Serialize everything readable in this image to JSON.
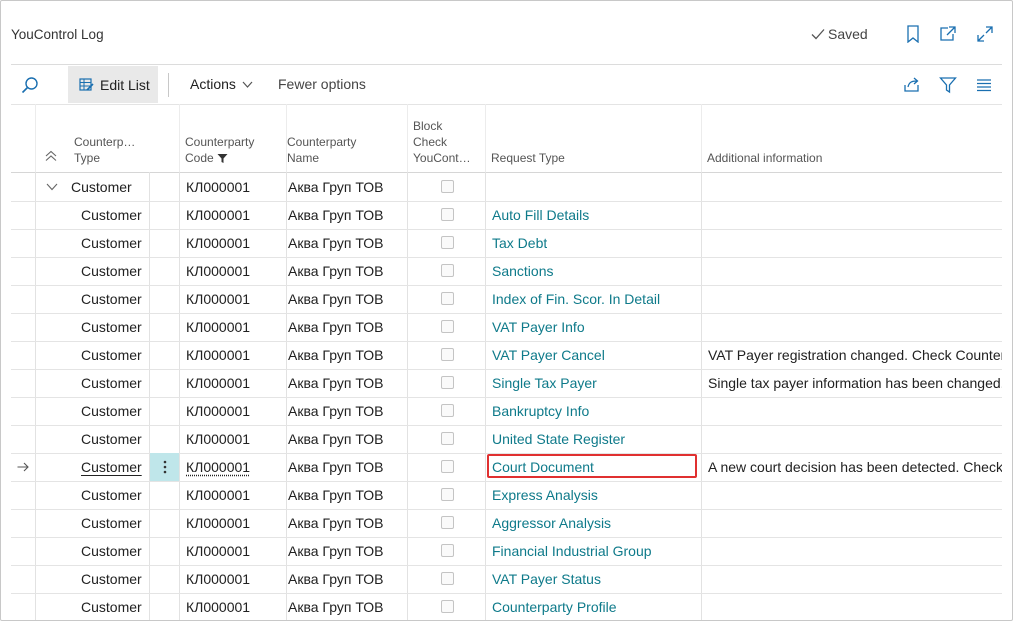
{
  "window": {
    "title": "YouControl Log",
    "saved_label": "Saved"
  },
  "actionbar": {
    "edit_list": "Edit List",
    "actions": "Actions",
    "fewer_options": "Fewer options"
  },
  "columns": {
    "type": [
      "Counterp…",
      "Type"
    ],
    "code": [
      "Counterparty",
      "Code"
    ],
    "name": [
      "Counterparty",
      "Name"
    ],
    "block": [
      "Block",
      "Check",
      "YouCont…"
    ],
    "request": "Request Type",
    "info": "Additional information"
  },
  "group_row": {
    "type": "Customer",
    "code": "КЛ000001",
    "name": "Аква Груп ТОВ"
  },
  "rows": [
    {
      "type": "Customer",
      "code": "КЛ000001",
      "name": "Аква Груп ТОВ",
      "request": "Auto Fill Details",
      "info": ""
    },
    {
      "type": "Customer",
      "code": "КЛ000001",
      "name": "Аква Груп ТОВ",
      "request": "Tax Debt",
      "info": ""
    },
    {
      "type": "Customer",
      "code": "КЛ000001",
      "name": "Аква Груп ТОВ",
      "request": "Sanctions",
      "info": ""
    },
    {
      "type": "Customer",
      "code": "КЛ000001",
      "name": "Аква Груп ТОВ",
      "request": "Index of Fin. Scor. In Detail",
      "info": ""
    },
    {
      "type": "Customer",
      "code": "КЛ000001",
      "name": "Аква Груп ТОВ",
      "request": "VAT Payer Info",
      "info": ""
    },
    {
      "type": "Customer",
      "code": "КЛ000001",
      "name": "Аква Груп ТОВ",
      "request": "VAT Payer Cancel",
      "info": "VAT Payer registration changed. Check Counterp"
    },
    {
      "type": "Customer",
      "code": "КЛ000001",
      "name": "Аква Груп ТОВ",
      "request": "Single Tax Payer",
      "info": "Single tax payer information has been changed."
    },
    {
      "type": "Customer",
      "code": "КЛ000001",
      "name": "Аква Груп ТОВ",
      "request": "Bankruptcy Info",
      "info": ""
    },
    {
      "type": "Customer",
      "code": "КЛ000001",
      "name": "Аква Груп ТОВ",
      "request": "United State Register",
      "info": ""
    },
    {
      "type": "Customer",
      "code": "КЛ000001",
      "name": "Аква Груп ТОВ",
      "request": "Court Document",
      "info": "A new court decision has been detected. Check"
    },
    {
      "type": "Customer",
      "code": "КЛ000001",
      "name": "Аква Груп ТОВ",
      "request": "Express Analysis",
      "info": ""
    },
    {
      "type": "Customer",
      "code": "КЛ000001",
      "name": "Аква Груп ТОВ",
      "request": "Aggressor Analysis",
      "info": ""
    },
    {
      "type": "Customer",
      "code": "КЛ000001",
      "name": "Аква Груп ТОВ",
      "request": "Financial Industrial Group",
      "info": ""
    },
    {
      "type": "Customer",
      "code": "КЛ000001",
      "name": "Аква Груп ТОВ",
      "request": "VAT Payer Status",
      "info": ""
    },
    {
      "type": "Customer",
      "code": "КЛ000001",
      "name": "Аква Груп ТОВ",
      "request": "Counterparty Profile",
      "info": ""
    }
  ],
  "selected_row_index": 9,
  "colors": {
    "link": "#0e7a8a",
    "highlight": "#e03030",
    "selected_cell": "#bfe6ea"
  }
}
